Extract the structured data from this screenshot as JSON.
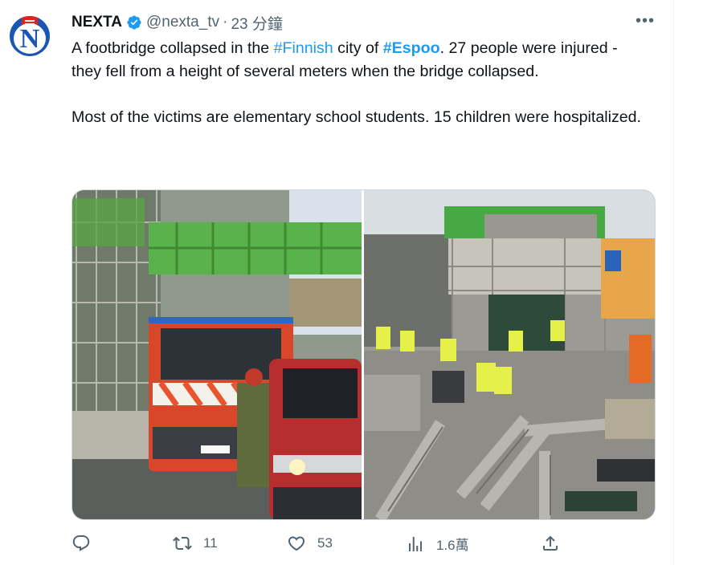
{
  "author": {
    "name": "NEXTA",
    "handle": "@nexta_tv",
    "separator": "·",
    "time": "23 分鐘"
  },
  "more_label": "•••",
  "tweet": {
    "line1_before": "A footbridge collapsed in the ",
    "hashtag1": "#Finnish",
    "line1_mid": " city of ",
    "hashtag2": "#Espoo",
    "line1_after": ". 27 people were injured - they fell from a height of several meters when the bridge collapsed.",
    "paragraph2": "Most of the victims are elementary school students. 15 children were hospitalized."
  },
  "actions": {
    "reply_count": "",
    "retweet_count": "11",
    "like_count": "53",
    "views_count": "1.6萬"
  },
  "colors": {
    "accent": "#1d9bf0",
    "text": "#0f1419",
    "muted": "#536471"
  },
  "icons": [
    "verified-badge-icon",
    "more-icon",
    "reply-icon",
    "retweet-icon",
    "like-icon",
    "views-icon",
    "share-icon"
  ]
}
